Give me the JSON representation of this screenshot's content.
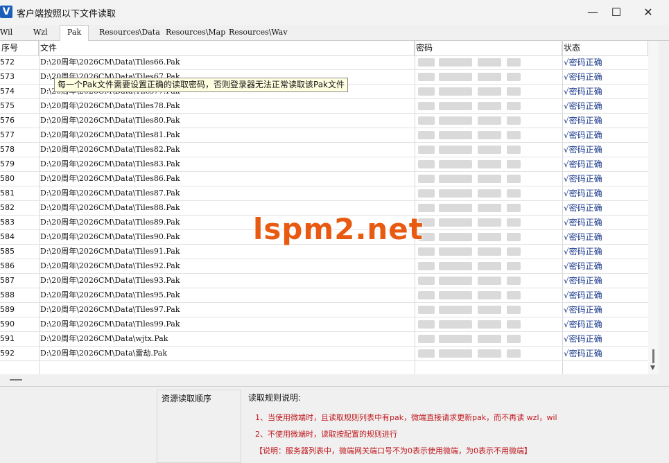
{
  "window": {
    "title": "客户端按照以下文件读取",
    "icon_letter": "V",
    "minimize": "—",
    "maximize": "☐",
    "close": "✕"
  },
  "tabs": [
    {
      "label": "Wil"
    },
    {
      "label": "Wzl"
    },
    {
      "label": "Pak",
      "active": true
    },
    {
      "label": "Resources\\Data"
    },
    {
      "label": "Resources\\Map"
    },
    {
      "label": "Resources\\Wav"
    }
  ],
  "table": {
    "columns": {
      "index": "序号",
      "file": "文件",
      "password": "密码",
      "status": "状态"
    },
    "rows": [
      {
        "index": "572",
        "file": "D:\\20周年\\2026CM\\Data\\Tiles66.Pak",
        "status": "√密码正确"
      },
      {
        "index": "573",
        "file": "D:\\20周年\\2026CM\\Data\\Tiles67.Pak",
        "status": "√密码正确"
      },
      {
        "index": "574",
        "file": "D:\\20周年\\2026CM\\Data\\Tiles77.Pak",
        "status": "√密码正确"
      },
      {
        "index": "575",
        "file": "D:\\20周年\\2026CM\\Data\\Tiles78.Pak",
        "status": "√密码正确"
      },
      {
        "index": "576",
        "file": "D:\\20周年\\2026CM\\Data\\Tiles80.Pak",
        "status": "√密码正确"
      },
      {
        "index": "577",
        "file": "D:\\20周年\\2026CM\\Data\\Tiles81.Pak",
        "status": "√密码正确"
      },
      {
        "index": "578",
        "file": "D:\\20周年\\2026CM\\Data\\Tiles82.Pak",
        "status": "√密码正确"
      },
      {
        "index": "579",
        "file": "D:\\20周年\\2026CM\\Data\\Tiles83.Pak",
        "status": "√密码正确"
      },
      {
        "index": "580",
        "file": "D:\\20周年\\2026CM\\Data\\Tiles86.Pak",
        "status": "√密码正确"
      },
      {
        "index": "581",
        "file": "D:\\20周年\\2026CM\\Data\\Tiles87.Pak",
        "status": "√密码正确"
      },
      {
        "index": "582",
        "file": "D:\\20周年\\2026CM\\Data\\Tiles88.Pak",
        "status": "√密码正确"
      },
      {
        "index": "583",
        "file": "D:\\20周年\\2026CM\\Data\\Tiles89.Pak",
        "status": "√密码正确"
      },
      {
        "index": "584",
        "file": "D:\\20周年\\2026CM\\Data\\Tiles90.Pak",
        "status": "√密码正确"
      },
      {
        "index": "585",
        "file": "D:\\20周年\\2026CM\\Data\\Tiles91.Pak",
        "status": "√密码正确"
      },
      {
        "index": "586",
        "file": "D:\\20周年\\2026CM\\Data\\Tiles92.Pak",
        "status": "√密码正确"
      },
      {
        "index": "587",
        "file": "D:\\20周年\\2026CM\\Data\\Tiles93.Pak",
        "status": "√密码正确"
      },
      {
        "index": "588",
        "file": "D:\\20周年\\2026CM\\Data\\Tiles95.Pak",
        "status": "√密码正确"
      },
      {
        "index": "589",
        "file": "D:\\20周年\\2026CM\\Data\\Tiles97.Pak",
        "status": "√密码正确"
      },
      {
        "index": "590",
        "file": "D:\\20周年\\2026CM\\Data\\Tiles99.Pak",
        "status": "√密码正确"
      },
      {
        "index": "591",
        "file": "D:\\20周年\\2026CM\\Data\\wjtx.Pak",
        "status": "√密码正确"
      },
      {
        "index": "592",
        "file": "D:\\20周年\\2026CM\\Data\\雷劫.Pak",
        "status": "√密码正确"
      }
    ]
  },
  "tooltip": "每一个Pak文件需要设置正确的读取密码，否则登录器无法正常读取该Pak文件",
  "watermark": "lspm2.net",
  "bottom": {
    "resource_order_title": "资源读取顺序",
    "rules_title": "读取规则说明:",
    "rules": [
      "1、当使用微端时，且读取规则列表中有pak，微端直接请求更新pak，而不再读 wzl，wil",
      "2、不使用微端时，读取按配置的规则进行",
      "【说明：服务器列表中，微端网关端口号不为0表示使用微端，为0表示不用微端】"
    ]
  },
  "colors": {
    "status_text": "#1a3a8a",
    "rule_text": "#c0191f",
    "watermark": "#e85a12"
  }
}
